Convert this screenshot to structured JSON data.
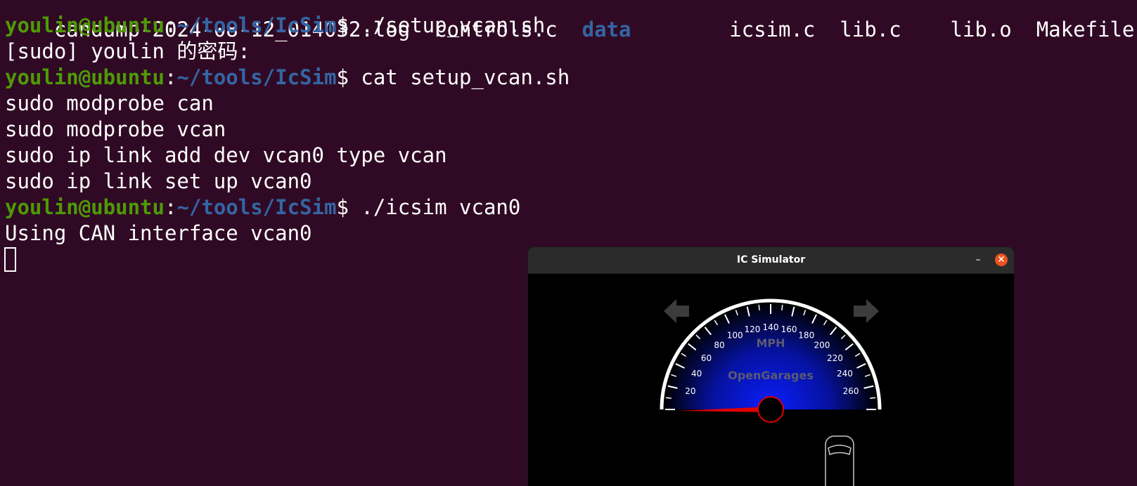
{
  "terminal": {
    "top_partial": [
      "candump-2024-08-12_014032.log",
      "controls.c",
      "data",
      "icsim.c",
      "lib.c",
      "lib.o",
      "Makefile"
    ],
    "prompt": {
      "user": "youlin@ubuntu",
      "colon": ":",
      "path": "~/tools/IcSim",
      "dollar": "$ "
    },
    "lines": [
      {
        "type": "prompt",
        "cmd": "./setup_vcan.sh"
      },
      {
        "type": "out",
        "text": "[sudo] youlin 的密码:"
      },
      {
        "type": "prompt",
        "cmd": "cat setup_vcan.sh"
      },
      {
        "type": "out",
        "text": "sudo modprobe can"
      },
      {
        "type": "out",
        "text": "sudo modprobe vcan"
      },
      {
        "type": "out",
        "text": "sudo ip link add dev vcan0 type vcan"
      },
      {
        "type": "out",
        "text": "sudo ip link set up vcan0"
      },
      {
        "type": "prompt",
        "cmd": "./icsim vcan0"
      },
      {
        "type": "out",
        "text": "Using CAN interface vcan0"
      }
    ]
  },
  "ic_window": {
    "title": "IC Simulator",
    "minimize_label": "–",
    "close_label": "×",
    "gauge": {
      "unit": "MPH",
      "brand": "OpenGarages",
      "ticks": [
        "20",
        "40",
        "60",
        "80",
        "100",
        "120",
        "140",
        "160",
        "180",
        "200",
        "220",
        "240",
        "260"
      ],
      "speed_value": 0
    },
    "colors": {
      "needle": "#e00000",
      "dial_center": "#0a1eff",
      "accent": "#e95420"
    }
  }
}
